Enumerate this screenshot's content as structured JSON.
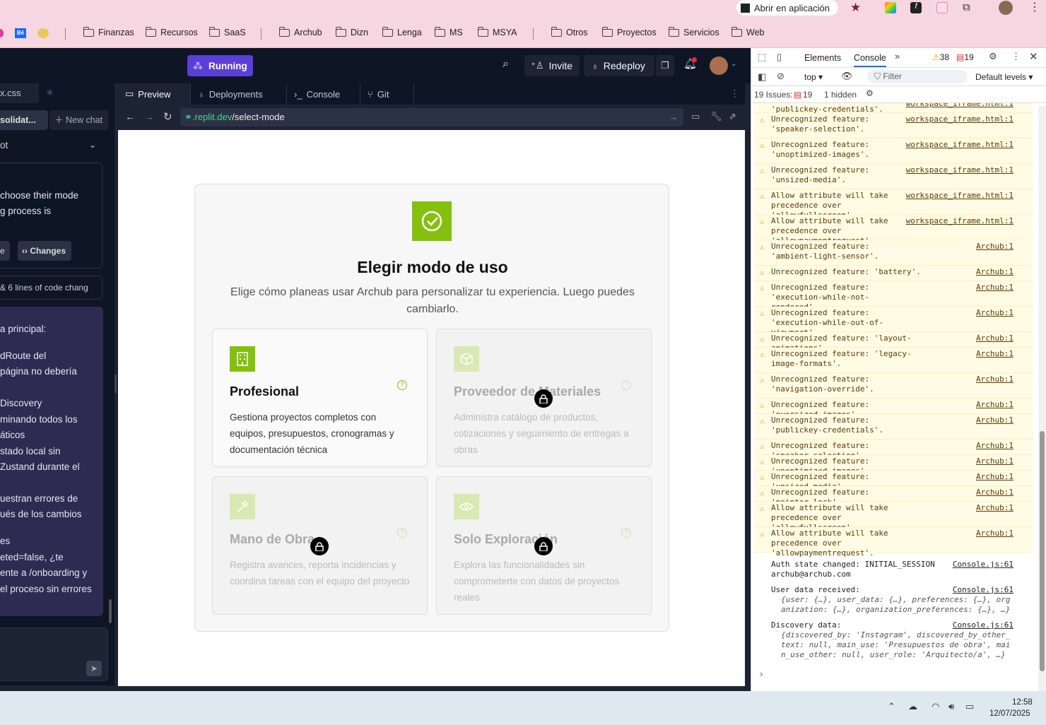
{
  "browser": {
    "open_app_label": "Abrir en aplicación",
    "bookmarks": [
      "Finanzas",
      "Recursos",
      "SaaS",
      "Archub",
      "Dizn",
      "Lenga",
      "MS",
      "MSYA",
      "Otros",
      "Proyectos",
      "Servicios",
      "Web"
    ]
  },
  "replit": {
    "running_label": "Running",
    "invite_label": "Invite",
    "redeploy_label": "Redeploy",
    "file_tab": "x.css",
    "chat_title": "solidat...",
    "new_chat_label": "New chat",
    "agent_label": "ot",
    "chat_text": [
      "choose their mode",
      "g process is"
    ],
    "changes_label": "Changes",
    "preview_btn": "e",
    "code_changes": "& 6 lines of code chang",
    "assistant_lines": [
      "a principal:",
      "",
      "dRoute del",
      "página no debería",
      "",
      "Discovery",
      "minando todos los",
      "áticos",
      "stado local sin",
      "Zustand durante el",
      "",
      "uestran errores de",
      "ués de los cambios",
      "",
      "es",
      "eted=false, ¿te",
      "ente a /onboarding y",
      "el proceso sin errores"
    ],
    "tabs": [
      "Preview",
      "Deployments",
      "Console",
      "Git"
    ],
    "url_domain": ".replit.dev",
    "url_path": "/select-mode"
  },
  "page": {
    "title": "Elegir modo de uso",
    "subtitle": "Elige cómo planeas usar Archub para personalizar tu experiencia. Luego puedes cambiarlo.",
    "cards": [
      {
        "title": "Profesional",
        "desc": "Gestiona proyectos completos con equipos, presupuestos, cronogramas y documentación técnica",
        "locked": false
      },
      {
        "title": "Proveedor de Materiales",
        "desc": "Administra catálogo de productos, cotizaciones y seguimiento de entregas a obras",
        "locked": true
      },
      {
        "title": "Mano de Obra",
        "desc": "Registra avances, reporta incidencias y coordina tareas con el equipo del proyecto",
        "locked": true
      },
      {
        "title": "Solo Exploración",
        "desc": "Explora las funcionalidades sin comprometerte con datos de proyectos reales",
        "locked": true
      }
    ]
  },
  "devtools": {
    "tabs": [
      "Elements",
      "Console"
    ],
    "warn_count": "38",
    "err_count": "19",
    "context": "top",
    "filter_placeholder": "Filter",
    "levels": "Default levels",
    "issues_label": "19 Issues:",
    "issues_count": "19",
    "hidden_label": "1 hidden",
    "messages": [
      {
        "t": "'publickey-credentials'.",
        "s": "workspace_iframe.html:1",
        "type": "warn",
        "partial": true
      },
      {
        "t": "Unrecognized feature: 'speaker-selection'.",
        "s": "workspace_iframe.html:1",
        "type": "warn"
      },
      {
        "t": "Unrecognized feature: 'unoptimized-images'.",
        "s": "workspace_iframe.html:1",
        "type": "warn"
      },
      {
        "t": "Unrecognized feature: 'unsized-media'.",
        "s": "workspace_iframe.html:1",
        "type": "warn"
      },
      {
        "t": "Allow attribute will take precedence over 'allowfullscreen'.",
        "s": "workspace_iframe.html:1",
        "type": "warn"
      },
      {
        "t": "Allow attribute will take precedence over 'allowpaymentrequest'.",
        "s": "workspace_iframe.html:1",
        "type": "warn"
      },
      {
        "t": "Unrecognized feature: 'ambient-light-sensor'.",
        "s": "Archub:1",
        "type": "warn"
      },
      {
        "t": "Unrecognized feature: 'battery'.",
        "s": "Archub:1",
        "type": "warn"
      },
      {
        "t": "Unrecognized feature: 'execution-while-not-rendered'.",
        "s": "Archub:1",
        "type": "warn"
      },
      {
        "t": "Unrecognized feature: 'execution-while-out-of-viewport'.",
        "s": "Archub:1",
        "type": "warn"
      },
      {
        "t": "Unrecognized feature: 'layout-animations'.",
        "s": "Archub:1",
        "type": "warn"
      },
      {
        "t": "Unrecognized feature: 'legacy-image-formats'.",
        "s": "Archub:1",
        "type": "warn"
      },
      {
        "t": "Unrecognized feature: 'navigation-override'.",
        "s": "Archub:1",
        "type": "warn"
      },
      {
        "t": "Unrecognized feature: 'oversized-images'.",
        "s": "Archub:1",
        "type": "warn"
      },
      {
        "t": "Unrecognized feature: 'publickey-credentials'.",
        "s": "Archub:1",
        "type": "warn"
      },
      {
        "t": "Unrecognized feature: 'speaker-selection'.",
        "s": "Archub:1",
        "type": "warn"
      },
      {
        "t": "Unrecognized feature: 'unoptimized-images'.",
        "s": "Archub:1",
        "type": "warn"
      },
      {
        "t": "Unrecognized feature: 'unsized-media'.",
        "s": "Archub:1",
        "type": "warn"
      },
      {
        "t": "Unrecognized feature: 'pointer-lock'.",
        "s": "Archub:1",
        "type": "warn"
      },
      {
        "t": "Allow attribute will take precedence over 'allowfullscreen'.",
        "s": "Archub:1",
        "type": "warn"
      },
      {
        "t": "Allow attribute will take precedence over 'allowpaymentrequest'.",
        "s": "Archub:1",
        "type": "warn"
      }
    ],
    "logs": [
      {
        "t": "Auth state changed: INITIAL_SESSION archub@archub.com",
        "s": "Console.js:61"
      },
      {
        "t": "User data received:",
        "s": "Console.js:61",
        "obj": "{user: {…}, user_data: {…}, preferences: {…}, organization: {…}, organization_preferences: {…}, …}"
      },
      {
        "t": "Discovery data:",
        "s": "Console.js:61",
        "obj": "{discovered_by: 'Instagram', discovered_by_other_text: null, main_use: 'Presupuestos de obra', main_use_other: null, user_role: 'Arquitecto/a', …}"
      }
    ]
  },
  "taskbar": {
    "time": "12:58",
    "date": "12/07/2025"
  },
  "colors": {
    "accent": "#84c00e",
    "running": "#5b3fd6"
  }
}
